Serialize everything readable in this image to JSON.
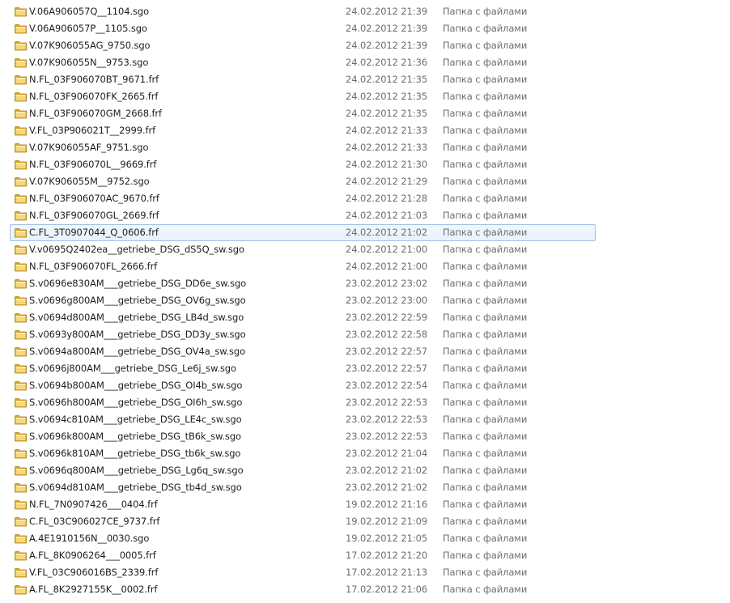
{
  "selected_index": 13,
  "files": [
    {
      "name": "V.06A906057Q__1104.sgo",
      "date": "24.02.2012 21:39",
      "type": "Папка с файлами"
    },
    {
      "name": "V.06A906057P__1105.sgo",
      "date": "24.02.2012 21:39",
      "type": "Папка с файлами"
    },
    {
      "name": "V.07K906055AG_9750.sgo",
      "date": "24.02.2012 21:39",
      "type": "Папка с файлами"
    },
    {
      "name": "V.07K906055N__9753.sgo",
      "date": "24.02.2012 21:36",
      "type": "Папка с файлами"
    },
    {
      "name": "N.FL_03F906070BT_9671.frf",
      "date": "24.02.2012 21:35",
      "type": "Папка с файлами"
    },
    {
      "name": "N.FL_03F906070FK_2665.frf",
      "date": "24.02.2012 21:35",
      "type": "Папка с файлами"
    },
    {
      "name": "N.FL_03F906070GM_2668.frf",
      "date": "24.02.2012 21:35",
      "type": "Папка с файлами"
    },
    {
      "name": "V.FL_03P906021T__2999.frf",
      "date": "24.02.2012 21:33",
      "type": "Папка с файлами"
    },
    {
      "name": "V.07K906055AF_9751.sgo",
      "date": "24.02.2012 21:33",
      "type": "Папка с файлами"
    },
    {
      "name": "N.FL_03F906070L__9669.frf",
      "date": "24.02.2012 21:30",
      "type": "Папка с файлами"
    },
    {
      "name": "V.07K906055M__9752.sgo",
      "date": "24.02.2012 21:29",
      "type": "Папка с файлами"
    },
    {
      "name": "N.FL_03F906070AC_9670.frf",
      "date": "24.02.2012 21:28",
      "type": "Папка с файлами"
    },
    {
      "name": "N.FL_03F906070GL_2669.frf",
      "date": "24.02.2012 21:03",
      "type": "Папка с файлами"
    },
    {
      "name": "C.FL_3T0907044_Q_0606.frf",
      "date": "24.02.2012 21:02",
      "type": "Папка с файлами"
    },
    {
      "name": "V.v0695Q2402ea__getriebe_DSG_dS5Q_sw.sgo",
      "date": "24.02.2012 21:00",
      "type": "Папка с файлами"
    },
    {
      "name": "N.FL_03F906070FL_2666.frf",
      "date": "24.02.2012 21:00",
      "type": "Папка с файлами"
    },
    {
      "name": "S.v0696e830AM___getriebe_DSG_DD6e_sw.sgo",
      "date": "23.02.2012 23:02",
      "type": "Папка с файлами"
    },
    {
      "name": "S.v0696g800AM___getriebe_DSG_OV6g_sw.sgo",
      "date": "23.02.2012 23:00",
      "type": "Папка с файлами"
    },
    {
      "name": "S.v0694d800AM___getriebe_DSG_LB4d_sw.sgo",
      "date": "23.02.2012 22:59",
      "type": "Папка с файлами"
    },
    {
      "name": "S.v0693y800AM___getriebe_DSG_DD3y_sw.sgo",
      "date": "23.02.2012 22:58",
      "type": "Папка с файлами"
    },
    {
      "name": "S.v0694a800AM___getriebe_DSG_OV4a_sw.sgo",
      "date": "23.02.2012 22:57",
      "type": "Папка с файлами"
    },
    {
      "name": "S.v0696j800AM___getriebe_DSG_Le6j_sw.sgo",
      "date": "23.02.2012 22:57",
      "type": "Папка с файлами"
    },
    {
      "name": "S.v0694b800AM___getriebe_DSG_OI4b_sw.sgo",
      "date": "23.02.2012 22:54",
      "type": "Папка с файлами"
    },
    {
      "name": "S.v0696h800AM___getriebe_DSG_OI6h_sw.sgo",
      "date": "23.02.2012 22:53",
      "type": "Папка с файлами"
    },
    {
      "name": "S.v0694c810AM___getriebe_DSG_LE4c_sw.sgo",
      "date": "23.02.2012 22:53",
      "type": "Папка с файлами"
    },
    {
      "name": "S.v0696k800AM___getriebe_DSG_tB6k_sw.sgo",
      "date": "23.02.2012 22:53",
      "type": "Папка с файлами"
    },
    {
      "name": "S.v0696k810AM___getriebe_DSG_tb6k_sw.sgo",
      "date": "23.02.2012 21:04",
      "type": "Папка с файлами"
    },
    {
      "name": "S.v0696q800AM___getriebe_DSG_Lg6q_sw.sgo",
      "date": "23.02.2012 21:02",
      "type": "Папка с файлами"
    },
    {
      "name": "S.v0694d810AM___getriebe_DSG_tb4d_sw.sgo",
      "date": "23.02.2012 21:02",
      "type": "Папка с файлами"
    },
    {
      "name": "N.FL_7N0907426___0404.frf",
      "date": "19.02.2012 21:16",
      "type": "Папка с файлами"
    },
    {
      "name": "C.FL_03C906027CE_9737.frf",
      "date": "19.02.2012 21:09",
      "type": "Папка с файлами"
    },
    {
      "name": "A.4E1910156N__0030.sgo",
      "date": "19.02.2012 21:05",
      "type": "Папка с файлами"
    },
    {
      "name": "A.FL_8K0906264___0005.frf",
      "date": "17.02.2012 21:20",
      "type": "Папка с файлами"
    },
    {
      "name": "V.FL_03C906016BS_2339.frf",
      "date": "17.02.2012 21:13",
      "type": "Папка с файлами"
    },
    {
      "name": "A.FL_8K2927155K__0002.frf",
      "date": "17.02.2012 21:06",
      "type": "Папка с файлами"
    }
  ]
}
